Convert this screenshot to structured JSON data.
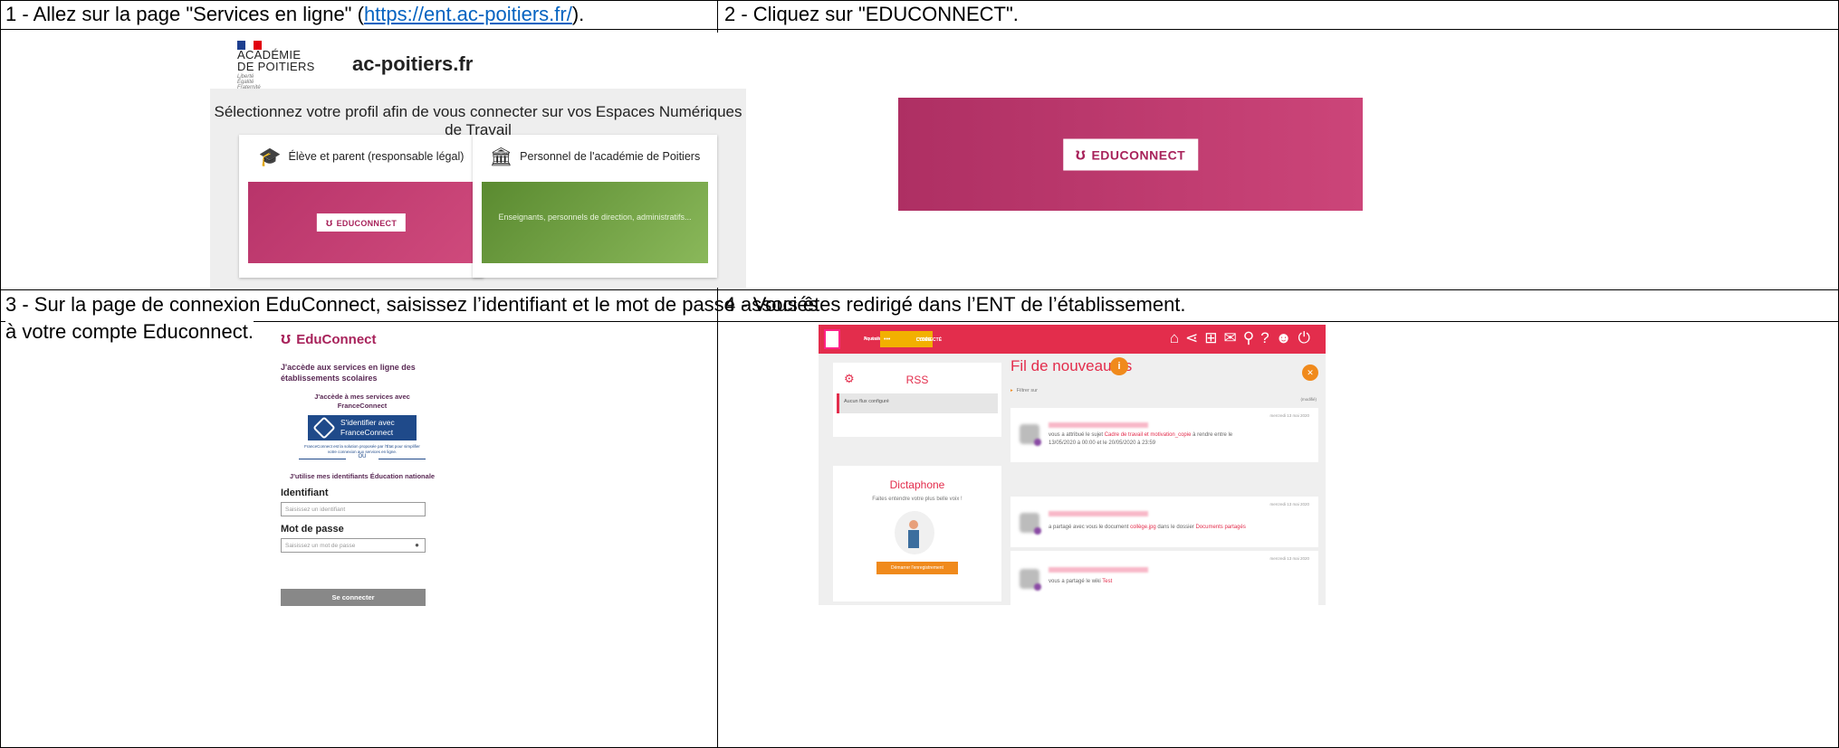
{
  "steps": {
    "s1": {
      "text": "1 - Allez sur la page \"Services en ligne\" (",
      "link": "https://ent.ac-poitiers.fr/",
      "tail": ")."
    },
    "s2": {
      "text": "2 - Cliquez sur \"EDUCONNECT\"."
    },
    "s3": {
      "line1": "3 - Sur la page de connexion EduConnect, saisissez l’identifiant et le mot de passe associés",
      "line2": "à votre compte Educonnect."
    },
    "s4": {
      "text": "4 - Vous êtes redirigé dans l’ENT de l’établissement."
    }
  },
  "panel1": {
    "academy_line1": "ACADÉMIE",
    "academy_line2": "DE POITIERS",
    "motto_1": "Liberté",
    "motto_2": "Égalité",
    "motto_3": "Fraternité",
    "site": "ac-poitiers.fr",
    "title": "Sélectionnez votre profil afin de vous connecter sur vos Espaces Numériques de Travail",
    "card_student": "Élève et parent (responsable légal)",
    "card_staff": "Personnel de l'académie de Poitiers",
    "educonnect_label": "EDUCONNECT",
    "staff_sub": "Enseignants, personnels de direction, administratifs..."
  },
  "panel2": {
    "educonnect_label": "EDUCONNECT"
  },
  "panel3": {
    "logo": "EduConnect",
    "heading_1": "J'accède aux services en ligne des",
    "heading_2": "établissements scolaires",
    "fc_1": "J'accède à mes services avec",
    "fc_2": "FranceConnect",
    "fc_btn_1": "S'identifier avec",
    "fc_btn_2": "FranceConnect",
    "fc_note_1": "FranceConnect est la solution proposée par l'État pour simplifier",
    "fc_note_2": "votre connexion aux services en ligne.",
    "or": "OU",
    "national": "J'utilise mes identifiants Éducation nationale",
    "id_label": "Identifiant",
    "id_placeholder": "Saisissez un identifiant",
    "pw_label": "Mot de passe",
    "pw_placeholder": "Saisissez un mot de passe",
    "submit": "Se connecter"
  },
  "panel4": {
    "region_1": "Nouvelle-",
    "region_2": "Aquitaine",
    "lycee_1": "LYCÉE",
    "lycee_2": "CONNECTÉ",
    "rss_title": "RSS",
    "rss_feed": "Aucun flux configuré",
    "dict_title": "Dictaphone",
    "dict_sub": "Faites entendre votre plus belle voix !",
    "dict_btn": "Démarrer l'enregistrement",
    "feed_title": "Fil de nouveautés",
    "feed_badge": "i",
    "filter": "Filtrer sur",
    "reset": "(modifié)",
    "items": [
      {
        "date": "mercredi 13 mai 2020",
        "pre": "vous a attribué le sujet ",
        "hl": "Cadre de travail et motivation_copie",
        "post": " à rendre entre le",
        "line2": "13/05/2020 à 00:00 et le 20/05/2020 à 23:59"
      },
      {
        "date": "mercredi 13 mai 2020",
        "pre": "a partagé avec vous le document ",
        "hl": "collège.jpg",
        "post": " dans le dossier ",
        "hl2": "Documents partagés"
      },
      {
        "date": "mercredi 13 mai 2020",
        "pre": "vous a partagé le wiki ",
        "hl": "Test"
      }
    ]
  },
  "colors": {
    "edu_pink": "#b8346a",
    "ent_red": "#e32d4c",
    "fc_blue": "#1f4a8a",
    "link": "#0563c1"
  }
}
